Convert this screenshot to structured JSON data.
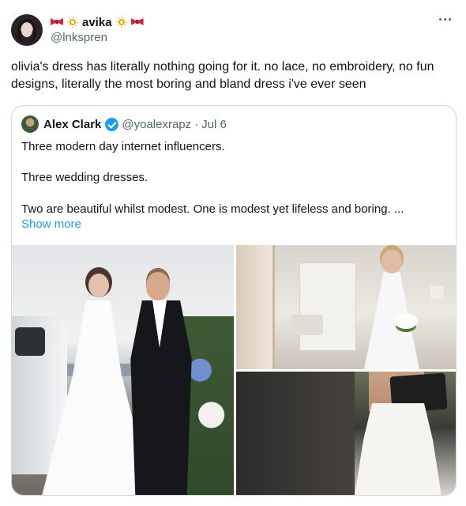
{
  "author": {
    "display_name": "avika",
    "handle": "@lnkspren",
    "emoji_before": [
      "ribbon-icon",
      "sun-icon"
    ],
    "emoji_after": [
      "sun-icon",
      "ribbon-icon"
    ]
  },
  "tweet": {
    "text": "olivia's dress has literally nothing going for it. no lace, no embroidery, no fun designs, literally the most boring and bland dress i've ever seen"
  },
  "quoted": {
    "display_name": "Alex Clark",
    "handle": "@yoalexrapz",
    "separator": "·",
    "date": "Jul 6",
    "lines": [
      "Three modern day internet influencers.",
      "Three wedding dresses.",
      "Two are beautiful whilst modest. One is modest yet lifeless and boring. ..."
    ],
    "show_more": "Show more",
    "verified": true
  },
  "colors": {
    "link": "#1d9bf0",
    "secondary_text": "#536471",
    "border": "#cfd9de",
    "ribbon": "#d1263a",
    "sun": "#e7a500"
  }
}
